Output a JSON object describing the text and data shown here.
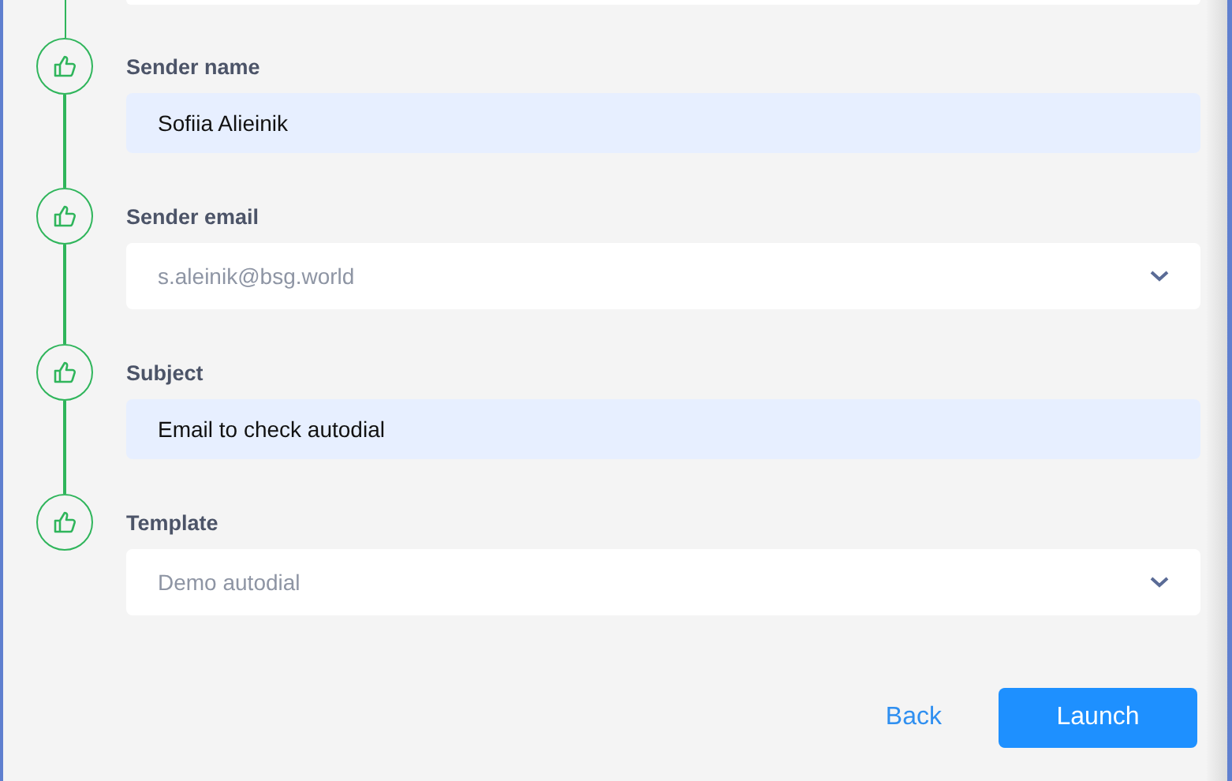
{
  "steps": [
    {
      "label": "Sender name",
      "kind": "text",
      "value": "Sofiia Alieinik",
      "done": true
    },
    {
      "label": "Sender email",
      "kind": "select",
      "placeholder": "s.aleinik@bsg.world",
      "done": true
    },
    {
      "label": "Subject",
      "kind": "text",
      "value": "Email to check autodial",
      "done": true
    },
    {
      "label": "Template",
      "kind": "select",
      "placeholder": "Demo autodial",
      "done": true
    }
  ],
  "buttons": [
    {
      "label": "Back",
      "kind": "link"
    },
    {
      "label": "Launch",
      "kind": "primary"
    }
  ]
}
